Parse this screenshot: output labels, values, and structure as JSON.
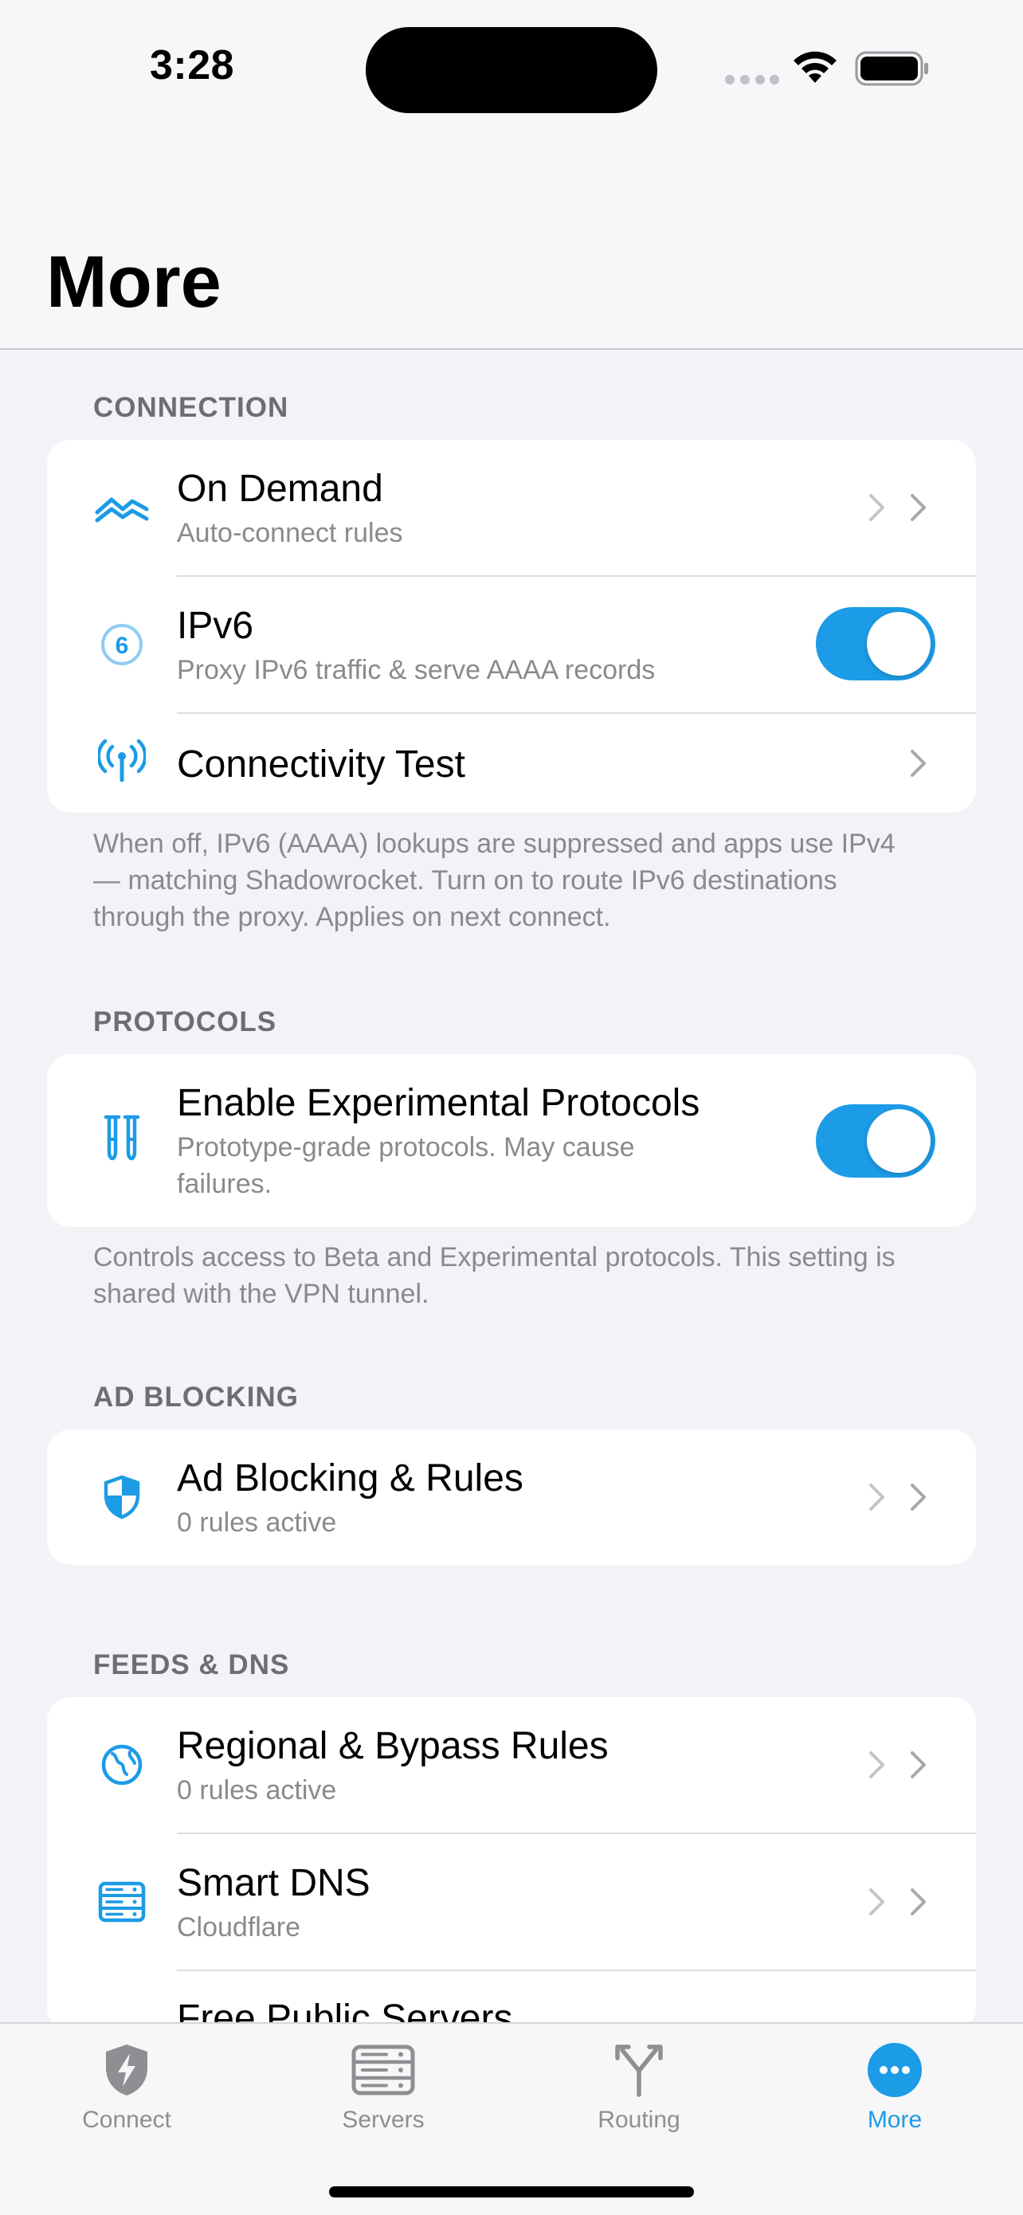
{
  "status_bar": {
    "time": "3:28"
  },
  "header": {
    "title": "More"
  },
  "sections": {
    "connection": {
      "label": "CONNECTION",
      "on_demand": {
        "title": "On Demand",
        "subtitle": "Auto-connect rules"
      },
      "ipv6": {
        "title": "IPv6",
        "subtitle": "Proxy IPv6 traffic & serve AAAA records",
        "enabled": true
      },
      "connectivity_test": {
        "title": "Connectivity Test"
      },
      "footer": "When off, IPv6 (AAAA) lookups are suppressed and apps use IPv4 — matching Shadowrocket. Turn on to route IPv6 destinations through the proxy. Applies on next connect."
    },
    "protocols": {
      "label": "PROTOCOLS",
      "experimental": {
        "title": "Enable Experimental Protocols",
        "subtitle": "Prototype-grade protocols. May cause failures.",
        "enabled": true
      },
      "footer": "Controls access to Beta and Experimental protocols. This setting is shared with the VPN tunnel."
    },
    "ad_blocking": {
      "label": "AD BLOCKING",
      "rules": {
        "title": "Ad Blocking & Rules",
        "subtitle": "0 rules active"
      }
    },
    "feeds_dns": {
      "label": "FEEDS & DNS",
      "regional": {
        "title": "Regional & Bypass Rules",
        "subtitle": "0 rules active"
      },
      "smart_dns": {
        "title": "Smart DNS",
        "subtitle": "Cloudflare"
      },
      "free_servers": {
        "title": "Free Public Servers"
      }
    }
  },
  "tabs": [
    {
      "label": "Connect",
      "icon": "shield-bolt-icon"
    },
    {
      "label": "Servers",
      "icon": "server-rack-icon"
    },
    {
      "label": "Routing",
      "icon": "fork-arrow-icon"
    },
    {
      "label": "More",
      "icon": "ellipsis-circle-icon",
      "active": true
    }
  ],
  "colors": {
    "accent": "#1c9be6",
    "background": "#f2f2f7",
    "secondary_text": "#8a8a8e"
  }
}
